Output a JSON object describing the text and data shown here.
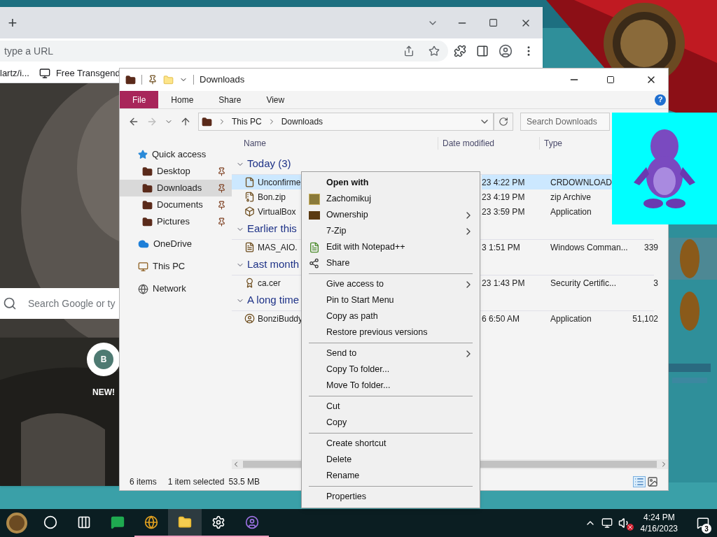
{
  "browser": {
    "new_tab": "+",
    "omnibox_placeholder": "type a URL",
    "bookmarks": [
      "lartz/i...",
      "Free Transgend"
    ],
    "search_placeholder": "Search Google or ty",
    "shortcuts": [
      {
        "letter": "B",
        "label": "NEW!"
      }
    ]
  },
  "explorer": {
    "title": "Downloads",
    "ribbon_tabs": [
      {
        "label": "File",
        "selected": true
      },
      {
        "label": "Home",
        "selected": false
      },
      {
        "label": "Share",
        "selected": false
      },
      {
        "label": "View",
        "selected": false
      }
    ],
    "help": "?",
    "breadcrumb": [
      "This PC",
      "Downloads"
    ],
    "search_placeholder": "Search Downloads",
    "nav": [
      {
        "label": "Quick access",
        "selected": false,
        "children": [
          {
            "label": "Desktop",
            "pinned": true,
            "selected": false
          },
          {
            "label": "Downloads",
            "pinned": true,
            "selected": true
          },
          {
            "label": "Documents",
            "pinned": true,
            "selected": false
          },
          {
            "label": "Pictures",
            "pinned": true,
            "selected": false
          }
        ]
      },
      {
        "label": "OneDrive",
        "selected": false
      },
      {
        "label": "This PC",
        "selected": false
      },
      {
        "label": "Network",
        "selected": false
      }
    ],
    "columns": [
      "Name",
      "Date modified",
      "Type"
    ],
    "groups": [
      {
        "title": "Today (3)",
        "expanded": true,
        "rows": [
          {
            "name": "Unconfirme",
            "date": "23 4:22 PM",
            "type": "CRDOWNLOAD",
            "selected": true
          },
          {
            "name": "Bon.zip",
            "date": "23 4:19 PM",
            "type": "zip Archive",
            "selected": false
          },
          {
            "name": "VirtualBox",
            "date": "23 3:59 PM",
            "type": "Application",
            "selected": false
          }
        ]
      },
      {
        "title": "Earlier this",
        "expanded": true,
        "rows": [
          {
            "name": "MAS_AIO.",
            "date": "3 1:51 PM",
            "type": "Windows Comman...",
            "size": "339",
            "selected": false
          }
        ]
      },
      {
        "title": "Last month",
        "expanded": true,
        "rows": [
          {
            "name": "ca.cer",
            "date": "23 1:43 PM",
            "type": "Security Certific...",
            "size": "3",
            "selected": false
          }
        ]
      },
      {
        "title": "A long time",
        "expanded": true,
        "rows": [
          {
            "name": "BonziBuddy",
            "date": "6 6:50 AM",
            "type": "Application",
            "size": "51,102",
            "selected": false
          }
        ]
      }
    ],
    "status": {
      "count": "6 items",
      "selection": "1 item selected",
      "size": "53.5 MB"
    }
  },
  "context_menu": {
    "groups": [
      [
        {
          "label": "Open with",
          "default": true,
          "submenu": false
        },
        {
          "label": "Zachomikuj",
          "default": false,
          "submenu": false
        },
        {
          "label": "Ownership",
          "default": false,
          "submenu": true
        },
        {
          "label": "7-Zip",
          "default": false,
          "submenu": true
        },
        {
          "label": "Edit with Notepad++",
          "default": false,
          "submenu": false
        },
        {
          "label": "Share",
          "default": false,
          "submenu": false
        }
      ],
      [
        {
          "label": "Give access to",
          "default": false,
          "submenu": true
        },
        {
          "label": "Pin to Start Menu",
          "default": false,
          "submenu": false
        },
        {
          "label": "Copy as path",
          "default": false,
          "submenu": false
        },
        {
          "label": "Restore previous versions",
          "default": false,
          "submenu": false
        }
      ],
      [
        {
          "label": "Send to",
          "default": false,
          "submenu": true
        },
        {
          "label": "Copy To folder...",
          "default": false,
          "submenu": false
        },
        {
          "label": "Move To folder...",
          "default": false,
          "submenu": false
        }
      ],
      [
        {
          "label": "Cut",
          "default": false,
          "submenu": false
        },
        {
          "label": "Copy",
          "default": false,
          "submenu": false
        }
      ],
      [
        {
          "label": "Create shortcut",
          "default": false,
          "submenu": false
        },
        {
          "label": "Delete",
          "default": false,
          "submenu": false
        },
        {
          "label": "Rename",
          "default": false,
          "submenu": false
        }
      ],
      [
        {
          "label": "Properties",
          "default": false,
          "submenu": false
        }
      ]
    ]
  },
  "taskbar": {
    "apps": [
      {
        "running": false,
        "active": false
      },
      {
        "running": true,
        "active": false
      },
      {
        "running": true,
        "active": true
      },
      {
        "running": true,
        "active": false
      },
      {
        "running": true,
        "active": false
      }
    ],
    "time": "4:24 PM",
    "date": "4/16/2023",
    "notifications": "3",
    "muted": true
  }
}
